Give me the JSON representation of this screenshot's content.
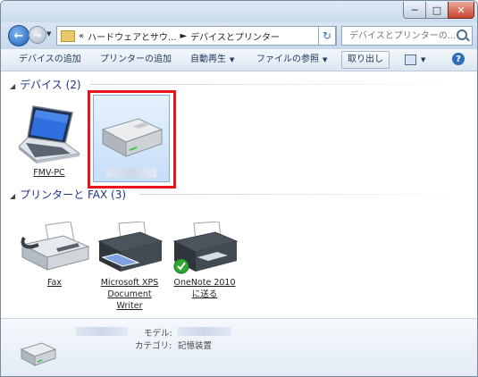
{
  "address_bar": {
    "overflow": "«",
    "crumb1": "ハードウェアとサウ...",
    "crumb2": "デバイスとプリンター"
  },
  "search": {
    "placeholder": "デバイスとプリンターの..."
  },
  "toolbar": {
    "add_device": "デバイスの追加",
    "add_printer": "プリンターの追加",
    "autoplay": "自動再生",
    "browse_files": "ファイルの参照",
    "eject": "取り出し",
    "help": "?"
  },
  "devices_group": {
    "header": "デバイス (2)",
    "items": [
      {
        "label": "FMV-PC"
      }
    ]
  },
  "printers_group": {
    "header": "プリンターと FAX (3)",
    "items": [
      {
        "label": "Fax"
      },
      {
        "label": "Microsoft XPS Document Writer"
      },
      {
        "label": "OneNote 2010 に送る"
      }
    ]
  },
  "details": {
    "model_label": "モデル:",
    "category_label": "カテゴリ:",
    "category_value": "記憶装置"
  },
  "colors": {
    "highlight": "#e8141a",
    "group_header": "#1e3287",
    "selection": "#c6def9"
  }
}
